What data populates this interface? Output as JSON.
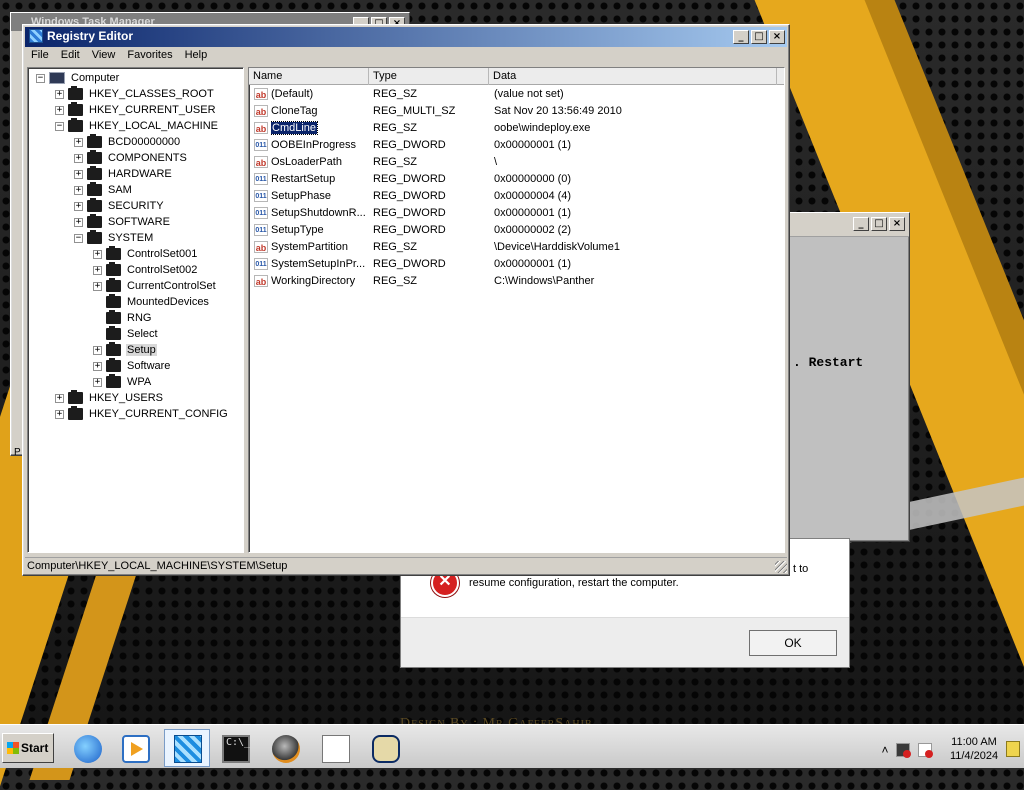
{
  "taskmgr": {
    "title": "Windows Task Manager",
    "footer_letter": "P"
  },
  "bgwin": {
    "text": ". Restart"
  },
  "errdlg": {
    "line1": "t to",
    "line2": "resume configuration, restart the computer.",
    "ok_label": "OK"
  },
  "regedit": {
    "title": "Registry Editor",
    "menu": [
      "File",
      "Edit",
      "View",
      "Favorites",
      "Help"
    ],
    "tree": [
      {
        "label": "Computer",
        "depth": 0,
        "expanded": true,
        "icon": "computer-icon"
      },
      {
        "label": "HKEY_CLASSES_ROOT",
        "depth": 1,
        "expanded": false
      },
      {
        "label": "HKEY_CURRENT_USER",
        "depth": 1,
        "expanded": false
      },
      {
        "label": "HKEY_LOCAL_MACHINE",
        "depth": 1,
        "expanded": true
      },
      {
        "label": "BCD00000000",
        "depth": 2,
        "expanded": false
      },
      {
        "label": "COMPONENTS",
        "depth": 2,
        "expanded": false
      },
      {
        "label": "HARDWARE",
        "depth": 2,
        "expanded": false
      },
      {
        "label": "SAM",
        "depth": 2,
        "expanded": false
      },
      {
        "label": "SECURITY",
        "depth": 2,
        "expanded": false
      },
      {
        "label": "SOFTWARE",
        "depth": 2,
        "expanded": false
      },
      {
        "label": "SYSTEM",
        "depth": 2,
        "expanded": true
      },
      {
        "label": "ControlSet001",
        "depth": 3,
        "expanded": false
      },
      {
        "label": "ControlSet002",
        "depth": 3,
        "expanded": false
      },
      {
        "label": "CurrentControlSet",
        "depth": 3,
        "expanded": false
      },
      {
        "label": "MountedDevices",
        "depth": 3,
        "leaf": true
      },
      {
        "label": "RNG",
        "depth": 3,
        "leaf": true
      },
      {
        "label": "Select",
        "depth": 3,
        "leaf": true
      },
      {
        "label": "Setup",
        "depth": 3,
        "expanded": false,
        "selected": true
      },
      {
        "label": "Software",
        "depth": 3,
        "expanded": false
      },
      {
        "label": "WPA",
        "depth": 3,
        "expanded": false
      },
      {
        "label": "HKEY_USERS",
        "depth": 1,
        "expanded": false
      },
      {
        "label": "HKEY_CURRENT_CONFIG",
        "depth": 1,
        "expanded": false
      }
    ],
    "columns": [
      "Name",
      "Type",
      "Data"
    ],
    "values": [
      {
        "name": "(Default)",
        "type": "REG_SZ",
        "data": "(value not set)",
        "icon": "ab"
      },
      {
        "name": "CloneTag",
        "type": "REG_MULTI_SZ",
        "data": "Sat Nov 20 13:56:49 2010",
        "icon": "ab"
      },
      {
        "name": "CmdLine",
        "type": "REG_SZ",
        "data": "oobe\\windeploy.exe",
        "icon": "ab",
        "selected": true
      },
      {
        "name": "OOBEInProgress",
        "type": "REG_DWORD",
        "data": "0x00000001 (1)",
        "icon": "dw"
      },
      {
        "name": "OsLoaderPath",
        "type": "REG_SZ",
        "data": "\\",
        "icon": "ab"
      },
      {
        "name": "RestartSetup",
        "type": "REG_DWORD",
        "data": "0x00000000 (0)",
        "icon": "dw"
      },
      {
        "name": "SetupPhase",
        "type": "REG_DWORD",
        "data": "0x00000004 (4)",
        "icon": "dw"
      },
      {
        "name": "SetupShutdownR...",
        "type": "REG_DWORD",
        "data": "0x00000001 (1)",
        "icon": "dw"
      },
      {
        "name": "SetupType",
        "type": "REG_DWORD",
        "data": "0x00000002 (2)",
        "icon": "dw"
      },
      {
        "name": "SystemPartition",
        "type": "REG_SZ",
        "data": "\\Device\\HarddiskVolume1",
        "icon": "ab"
      },
      {
        "name": "SystemSetupInPr...",
        "type": "REG_DWORD",
        "data": "0x00000001 (1)",
        "icon": "dw"
      },
      {
        "name": "WorkingDirectory",
        "type": "REG_SZ",
        "data": "C:\\Windows\\Panther",
        "icon": "ab"
      }
    ],
    "status": "Computer\\HKEY_LOCAL_MACHINE\\SYSTEM\\Setup"
  },
  "taskbar": {
    "start_label": "Start",
    "items": [
      {
        "name": "internet-explorer-icon"
      },
      {
        "name": "media-player-icon"
      },
      {
        "name": "registry-editor-icon",
        "active": true
      },
      {
        "name": "command-prompt-icon"
      },
      {
        "name": "setup-orb-icon"
      },
      {
        "name": "document-icon"
      },
      {
        "name": "clock-app-icon"
      }
    ],
    "time": "11:00 AM",
    "date": "11/4/2024"
  },
  "background": {
    "credit": "Design By : Mr GafferSahib"
  }
}
